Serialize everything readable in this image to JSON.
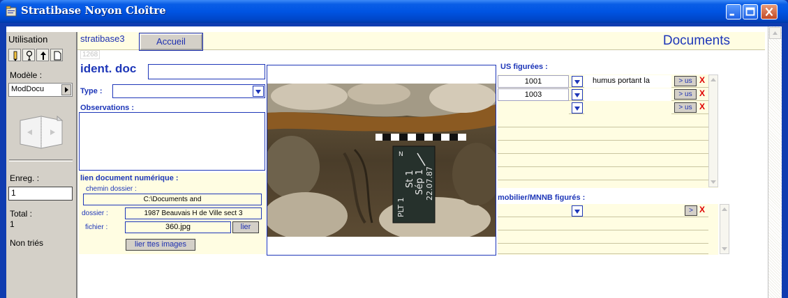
{
  "window": {
    "title": "Stratibase Noyon Cloître",
    "colors": {
      "titlebar": "#0054e3",
      "accent_blue": "#1d36b8",
      "panel_yellow": "#fffde2",
      "close_red": "#c24a26"
    }
  },
  "left_toolbar": {
    "mode_label": "Utilisation",
    "mode_icons": [
      "pencil-icon",
      "search-icon",
      "sort-icon",
      "page-icon"
    ],
    "model_label": "Modèle :",
    "model_value": "ModDocu",
    "record_label": "Enreg. :",
    "record_value": "1",
    "total_label": "Total :",
    "total_value": "1",
    "sort_status": "Non triés"
  },
  "header": {
    "db_name": "stratibase3",
    "home_button": "Accueil",
    "page_title": "Documents"
  },
  "form": {
    "record_id": "1268",
    "ident_label": "ident. doc",
    "ident_value": "",
    "type_label": "Type :",
    "type_value": "",
    "observations_label": "Observations :",
    "observations_value": "",
    "digital_link_label": "lien document numérique :",
    "folder_path_label": "chemin dossier :",
    "folder_path_value": "C:\\Documents and",
    "folder_label": "dossier :",
    "folder_value": "1987 Beauvais H de Ville sect 3",
    "file_label": "fichier :",
    "file_value": "360.jpg",
    "link_button": "lier",
    "link_all_button": "lier ttes images"
  },
  "photo": {
    "board_text": [
      "St 1",
      "Sép 1",
      "22.07.87"
    ],
    "board_side": "PLT 1",
    "north_mark": "N"
  },
  "us_figurees": {
    "label": "US figurées :",
    "goto_button": "> us",
    "delete_mark": "X",
    "rows": [
      {
        "us": "1001",
        "description": "humus portant la"
      },
      {
        "us": "1003",
        "description": ""
      },
      {
        "us": "",
        "description": ""
      }
    ]
  },
  "mobilier": {
    "label": "mobilier/MNNB figurés :",
    "goto_button": ">",
    "delete_mark": "X"
  }
}
